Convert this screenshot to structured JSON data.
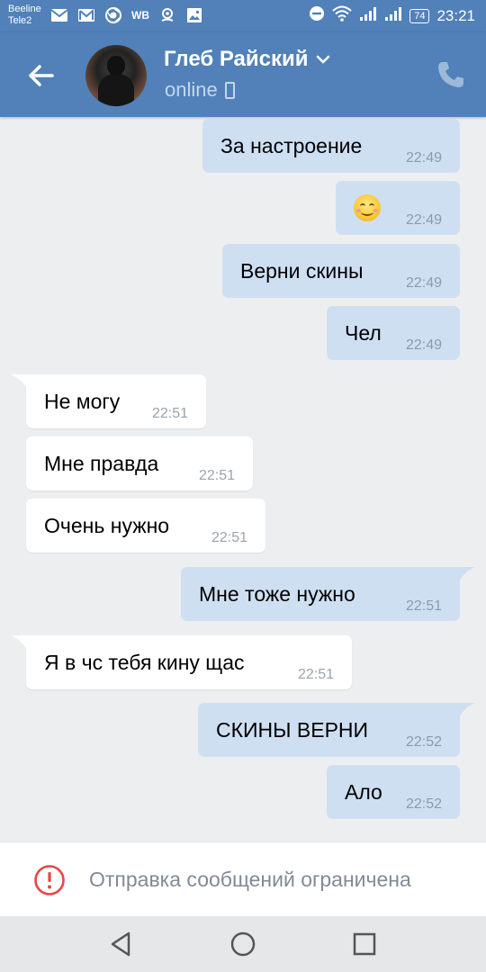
{
  "status_bar": {
    "carrier_1": "Beeline",
    "carrier_2": "Tele2",
    "left_icons": [
      "mail-icon",
      "gmail-icon",
      "chrome-icon",
      "wb-icon",
      "location-icon",
      "gallery-icon"
    ],
    "wb_label": "WB",
    "battery": "74",
    "time": "23:21"
  },
  "header": {
    "contact_name": "Глеб Райский",
    "status": "online"
  },
  "messages": [
    {
      "direction": "out",
      "text": "За настроение",
      "time": "22:49"
    },
    {
      "direction": "out",
      "text": "",
      "emoji": "smiling-face-icon",
      "time": "22:49"
    },
    {
      "direction": "out",
      "text": "Верни скины",
      "time": "22:49"
    },
    {
      "direction": "out",
      "text": "Чел",
      "time": "22:49"
    },
    {
      "direction": "in",
      "text": "Не могу",
      "time": "22:51"
    },
    {
      "direction": "in",
      "text": "Мне правда",
      "time": "22:51"
    },
    {
      "direction": "in",
      "text": "Очень нужно",
      "time": "22:51"
    },
    {
      "direction": "out",
      "text": "Мне тоже нужно",
      "time": "22:51"
    },
    {
      "direction": "in",
      "text": "Я в чс тебя кину щас",
      "time": "22:51"
    },
    {
      "direction": "out",
      "text": "СКИНЫ ВЕРНИ",
      "time": "22:52"
    },
    {
      "direction": "out",
      "text": "Ало",
      "time": "22:52"
    }
  ],
  "footer": {
    "restriction_text": "Отправка сообщений ограничена"
  },
  "colors": {
    "header_bg": "#5181b8",
    "outgoing_bubble": "#cfdff2",
    "incoming_bubble": "#ffffff",
    "chat_bg": "#edeef0",
    "warning_red": "#e64646"
  }
}
